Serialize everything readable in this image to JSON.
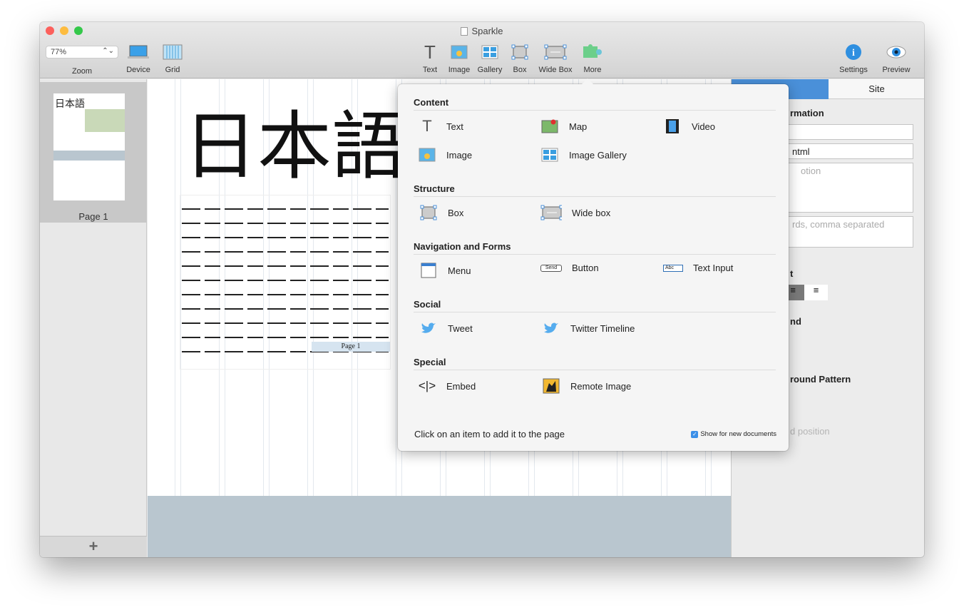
{
  "window": {
    "title": "Sparkle"
  },
  "toolbar": {
    "zoom_value": "77%",
    "left": [
      {
        "label": "Zoom"
      },
      {
        "label": "Device"
      },
      {
        "label": "Grid"
      }
    ],
    "center": [
      {
        "label": "Text"
      },
      {
        "label": "Image"
      },
      {
        "label": "Gallery"
      },
      {
        "label": "Box"
      },
      {
        "label": "Wide Box"
      },
      {
        "label": "More"
      }
    ],
    "right": [
      {
        "label": "Settings"
      },
      {
        "label": "Preview"
      }
    ]
  },
  "sidebar": {
    "pages": [
      {
        "label": "Page 1",
        "thumb_title": "日本語"
      }
    ],
    "add_label": "+"
  },
  "canvas": {
    "heading": "日本語",
    "page_label": "Page 1"
  },
  "inspector": {
    "tabs": [
      {
        "label": ""
      },
      {
        "label": "Site"
      }
    ],
    "section1": "rmation",
    "field2": "ntml",
    "field3_placeholder": "otion",
    "field4_placeholder": "rds, comma separated",
    "align_label": "t",
    "section2": "nd",
    "section3": "round Pattern",
    "section4": "d position"
  },
  "popover": {
    "sections": [
      {
        "title": "Content",
        "items": [
          {
            "label": "Text",
            "icon": "text-icon"
          },
          {
            "label": "Map",
            "icon": "map-icon"
          },
          {
            "label": "Video",
            "icon": "video-icon"
          },
          {
            "label": "Image",
            "icon": "image-icon"
          },
          {
            "label": "Image Gallery",
            "icon": "gallery-icon"
          }
        ]
      },
      {
        "title": "Structure",
        "items": [
          {
            "label": "Box",
            "icon": "box-icon"
          },
          {
            "label": "Wide box",
            "icon": "wide-box-icon"
          }
        ]
      },
      {
        "title": "Navigation and Forms",
        "items": [
          {
            "label": "Menu",
            "icon": "menu-icon"
          },
          {
            "label": "Button",
            "icon": "button-icon",
            "icon_text": "Send"
          },
          {
            "label": "Text Input",
            "icon": "text-input-icon",
            "icon_text": "Abc"
          }
        ]
      },
      {
        "title": "Social",
        "items": [
          {
            "label": "Tweet",
            "icon": "twitter-icon"
          },
          {
            "label": "Twitter Timeline",
            "icon": "twitter-icon"
          }
        ]
      },
      {
        "title": "Special",
        "items": [
          {
            "label": "Embed",
            "icon": "embed-icon"
          },
          {
            "label": "Remote Image",
            "icon": "remote-image-icon"
          }
        ]
      }
    ],
    "footer": "Click on an item to add it to the page",
    "checkbox_label": "Show for new documents",
    "checkbox_checked": true
  },
  "colors": {
    "accent": "#4a90d9",
    "twitter": "#55acee",
    "band": "#b9c6cf"
  }
}
